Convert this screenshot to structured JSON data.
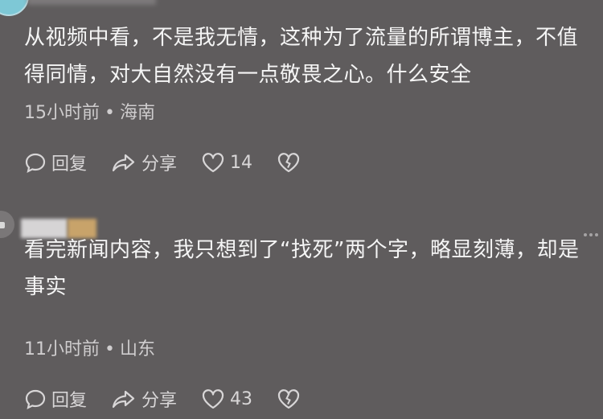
{
  "comments": [
    {
      "text": "从视频中看，不是我无情，这种为了流量的所谓博主，不值得同情，对大自然没有一点敬畏之心。什么安全",
      "time": "15小时前",
      "location": "海南",
      "reply_label": "回复",
      "share_label": "分享",
      "like_count": "14"
    },
    {
      "text": "看完新闻内容，我只想到了“找死”两个字，略显刻薄，却是事实",
      "time": "11小时前",
      "location": "山东",
      "reply_label": "回复",
      "share_label": "分享",
      "like_count": "43"
    }
  ],
  "meta_separator": "•",
  "colors": {
    "background": "#5f5c5d",
    "text": "#f5f5f5",
    "muted": "#cfcdce"
  }
}
